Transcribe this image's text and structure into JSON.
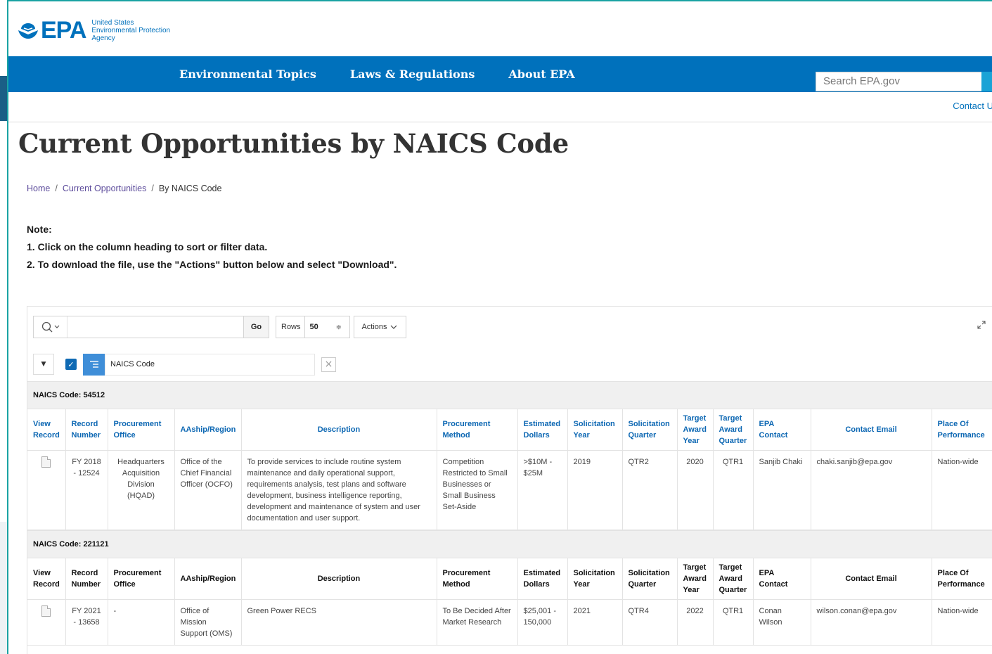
{
  "site": {
    "logo_text": "EPA",
    "logo_sub": "United States Environmental Protection Agency",
    "logo_sub_lines": [
      "United States",
      "Environmental Protection",
      "Agency"
    ],
    "nav": [
      "Environmental Topics",
      "Laws & Regulations",
      "About EPA"
    ],
    "search_placeholder": "Search EPA.gov",
    "contact_link": "Contact U"
  },
  "page": {
    "title": "Current Opportunities by NAICS Code",
    "breadcrumb": [
      "Home",
      "Current Opportunities",
      "By NAICS Code"
    ],
    "note_title": "Note:",
    "note_lines": [
      "1. Click on the column heading to sort or filter data.",
      "2. To download the file, use the \"Actions\" button below and select \"Download\"."
    ]
  },
  "toolbar": {
    "go_label": "Go",
    "rows_label": "Rows",
    "rows_value": "50",
    "actions_label": "Actions"
  },
  "filter": {
    "control_name": "NAICS Code"
  },
  "columns_row1": [
    "View Record",
    "Record Number",
    "Procurement Office",
    "AAship/Region",
    "Description",
    "Procurement Method",
    "Estimated Dollars",
    "Solicitation Year",
    "Solicitation Quarter",
    "Target Award Year",
    "Target Award Quarter",
    "EPA Contact",
    "Contact Email",
    "Place Of Performance"
  ],
  "columns_row2": [
    "View Record",
    "Record Number",
    "Procurement Office",
    "AAship/Region",
    "Description",
    "Procurement Method",
    "Estimated Dollars",
    "Solicitation Year",
    "Solicitation Quarter",
    "Target Award Year",
    "Target Award Quarter",
    "EPA Contact",
    "Contact Email",
    "Place Of Performance"
  ],
  "groups": [
    {
      "header": "NAICS Code: 54512",
      "row": {
        "record_number": "FY 2018 - 12524",
        "procurement_office": "Headquarters Acquisition Division (HQAD)",
        "aaship_region": "Office of the Chief Financial Officer (OCFO)",
        "description": "To provide services to include routine system maintenance and daily operational support, requirements analysis, test plans and software development, business intelligence reporting, development and maintenance of system and user documentation and user support.",
        "procurement_method": "Competition Restricted to Small Businesses or Small Business Set-Aside",
        "estimated_dollars": ">$10M - $25M",
        "solicitation_year": "2019",
        "solicitation_quarter": "QTR2",
        "target_award_year": "2020",
        "target_award_quarter": "QTR1",
        "epa_contact": "Sanjib Chaki",
        "contact_email": "chaki.sanjib@epa.gov",
        "place_of_performance": "Nation-wide"
      }
    },
    {
      "header": "NAICS Code: 221121",
      "row": {
        "record_number": "FY 2021 - 13658",
        "procurement_office": "-",
        "aaship_region": "Office of Mission Support (OMS)",
        "description": "Green Power RECS",
        "procurement_method": "To Be Decided After Market Research",
        "estimated_dollars": "$25,001 - 150,000",
        "solicitation_year": "2021",
        "solicitation_quarter": "QTR4",
        "target_award_year": "2022",
        "target_award_quarter": "QTR1",
        "epa_contact": "Conan Wilson",
        "contact_email": "wilson.conan@epa.gov",
        "place_of_performance": "Nation-wide"
      }
    }
  ],
  "colors": {
    "brand_blue": "#0071bc",
    "link_blue": "#0c67b3",
    "breadcrumb_purple": "#5c4b9b",
    "accent_teal": "#1aa3a3"
  },
  "icons": {
    "logo": "epa-flower-icon",
    "search": "magnifier-icon",
    "expand": "expand-diagonal-icon",
    "remove": "close-icon",
    "view_record": "document-icon"
  }
}
